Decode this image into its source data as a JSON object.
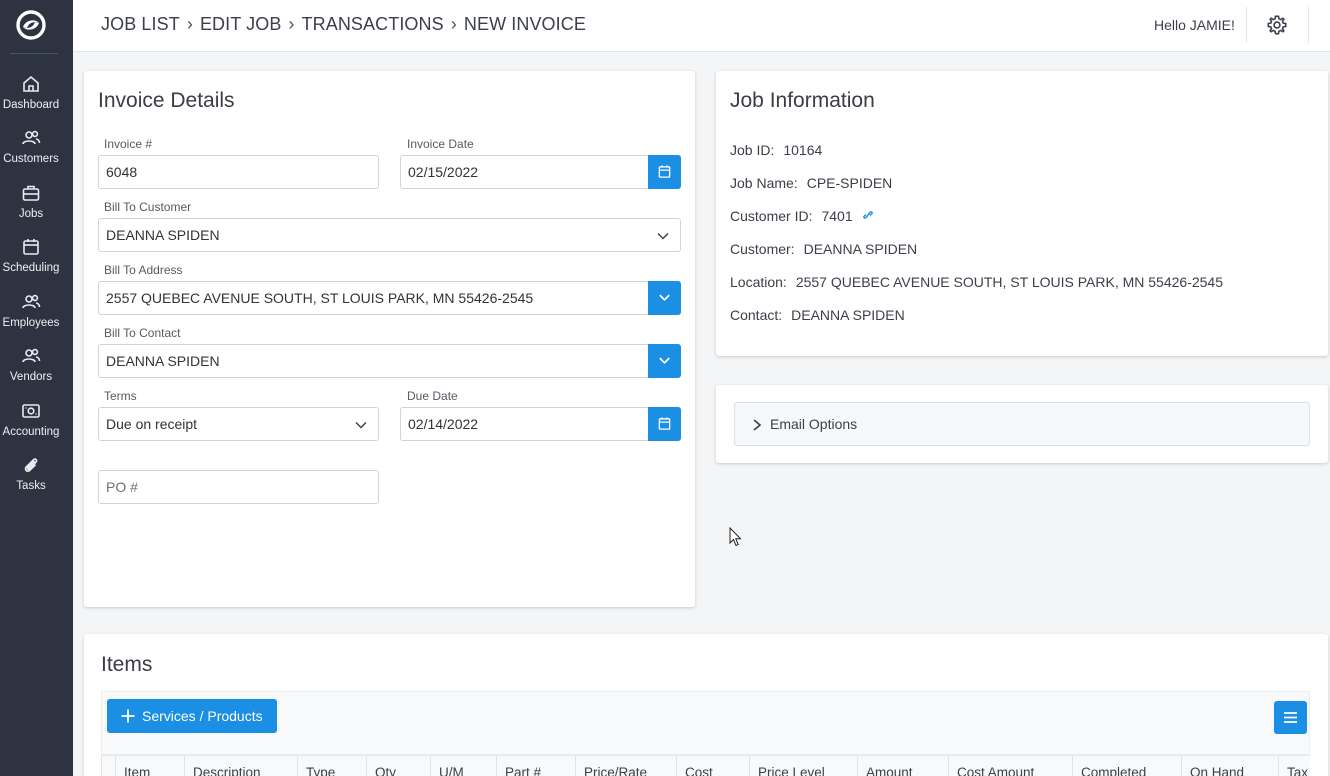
{
  "app": {
    "brand_color": "#1a8fe3",
    "sidebar_color": "#2d3340"
  },
  "sidebar": {
    "items": [
      {
        "label": "Dashboard",
        "icon": "home-icon"
      },
      {
        "label": "Customers",
        "icon": "customers-icon"
      },
      {
        "label": "Jobs",
        "icon": "briefcase-icon"
      },
      {
        "label": "Scheduling",
        "icon": "calendar-icon"
      },
      {
        "label": "Employees",
        "icon": "employees-icon"
      },
      {
        "label": "Vendors",
        "icon": "vendors-icon"
      },
      {
        "label": "Accounting",
        "icon": "money-icon"
      },
      {
        "label": "Tasks",
        "icon": "paperclip-icon"
      }
    ]
  },
  "header": {
    "breadcrumb": [
      "JOB LIST",
      "EDIT JOB",
      "TRANSACTIONS",
      "NEW INVOICE"
    ],
    "greeting": "Hello JAMIE!"
  },
  "invoice": {
    "title": "Invoice Details",
    "invoice_number_label": "Invoice #",
    "invoice_number": "6048",
    "invoice_date_label": "Invoice Date",
    "invoice_date": "02/15/2022",
    "bill_to_customer_label": "Bill To Customer",
    "bill_to_customer": "DEANNA SPIDEN",
    "bill_to_address_label": "Bill To Address",
    "bill_to_address": "2557 QUEBEC AVENUE SOUTH, ST LOUIS PARK, MN 55426-2545",
    "bill_to_contact_label": "Bill To Contact",
    "bill_to_contact": "DEANNA SPIDEN",
    "terms_label": "Terms",
    "terms": "Due on receipt",
    "due_date_label": "Due Date",
    "due_date": "02/14/2022",
    "po_placeholder": "PO #"
  },
  "job_info": {
    "title": "Job Information",
    "job_id_label": "Job ID:",
    "job_id": "10164",
    "job_name_label": "Job Name:",
    "job_name": "CPE-SPIDEN",
    "customer_id_label": "Customer ID:",
    "customer_id": "7401",
    "customer_label": "Customer:",
    "customer": "DEANNA SPIDEN",
    "location_label": "Location:",
    "location": "2557 QUEBEC AVENUE SOUTH, ST LOUIS PARK, MN 55426-2545",
    "contact_label": "Contact:",
    "contact": "DEANNA SPIDEN"
  },
  "email_options": {
    "label": "Email Options"
  },
  "items": {
    "title": "Items",
    "add_button": "Services / Products",
    "columns": [
      "Item",
      "Description",
      "Type",
      "Qty",
      "U/M",
      "Part #",
      "Price/Rate",
      "Cost",
      "Price Level",
      "Amount",
      "Cost Amount",
      "Completed",
      "On Hand",
      "Tax"
    ]
  }
}
